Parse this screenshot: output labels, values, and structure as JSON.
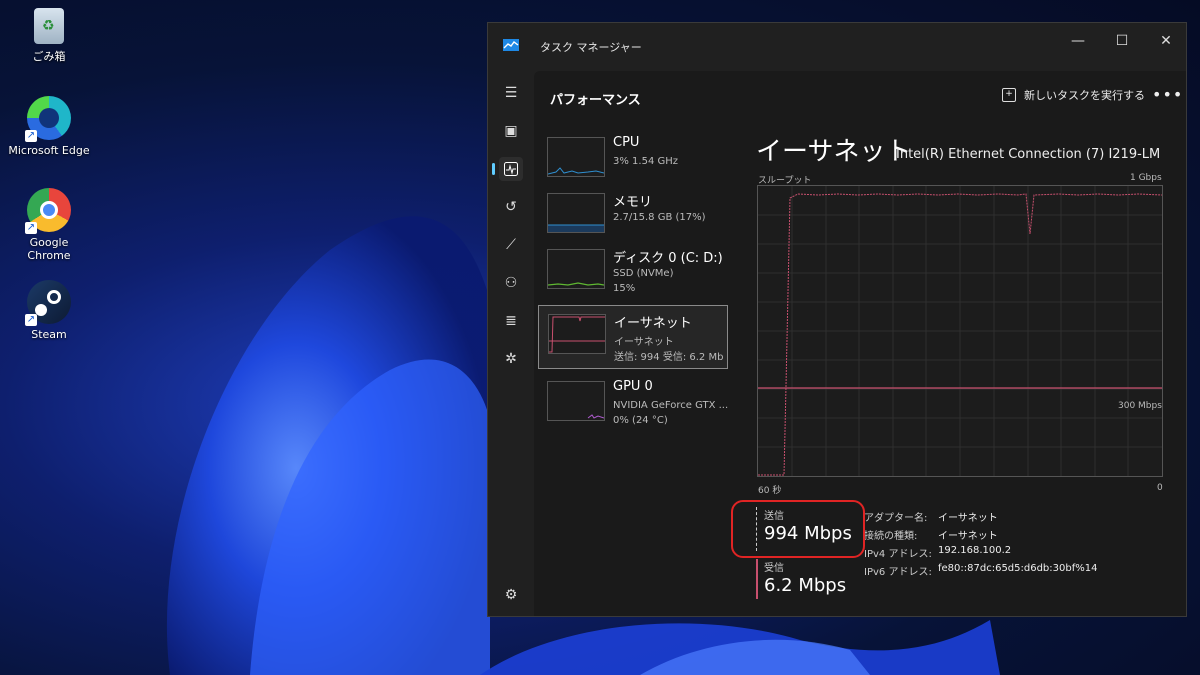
{
  "desktop": {
    "icons": [
      {
        "label": "ごみ箱"
      },
      {
        "label": "Microsoft Edge"
      },
      {
        "label": "Google Chrome"
      },
      {
        "label": "Steam"
      }
    ]
  },
  "window": {
    "title": "タスク マネージャー",
    "controls": {
      "minimize": "—",
      "maximize": "☐",
      "close": "✕"
    }
  },
  "header": {
    "page_title": "パフォーマンス",
    "new_task": "新しいタスクを実行する",
    "more": "•••"
  },
  "devices": [
    {
      "name": "CPU",
      "sub": "3%  1.54 GHz",
      "sub2": ""
    },
    {
      "name": "メモリ",
      "sub": "2.7/15.8 GB (17%)",
      "sub2": ""
    },
    {
      "name": "ディスク 0 (C: D:)",
      "sub": "SSD (NVMe)",
      "sub2": "15%"
    },
    {
      "name": "イーサネット",
      "sub": "イーサネット",
      "sub2": "送信: 994  受信: 6.2 Mb"
    },
    {
      "name": "GPU 0",
      "sub": "NVIDIA GeForce GTX ...",
      "sub2": "0%  (24 °C)"
    }
  ],
  "detail": {
    "title": "イーサネット",
    "adapter": "Intel(R) Ethernet Connection (7) I219-LM",
    "throughput_label": "スループット",
    "max_label": "1 Gbps",
    "mid_label": "300 Mbps",
    "time_left": "60 秒",
    "time_right": "0",
    "send_label": "送信",
    "send_value": "994 Mbps",
    "recv_label": "受信",
    "recv_value": "6.2 Mbps",
    "info": [
      {
        "k": "アダプター名:",
        "v": "イーサネット"
      },
      {
        "k": "接続の種類:",
        "v": "イーサネット"
      },
      {
        "k": "IPv4 アドレス:",
        "v": "192.168.100.2"
      },
      {
        "k": "IPv6 アドレス:",
        "v": "fe80::87dc:65d5:d6db:30bf%14"
      }
    ]
  },
  "colors": {
    "accent": "#60cdff",
    "eth": "#c8506e",
    "cpu": "#2f8fd0",
    "disk": "#5fb832",
    "highlight": "#e02424"
  }
}
